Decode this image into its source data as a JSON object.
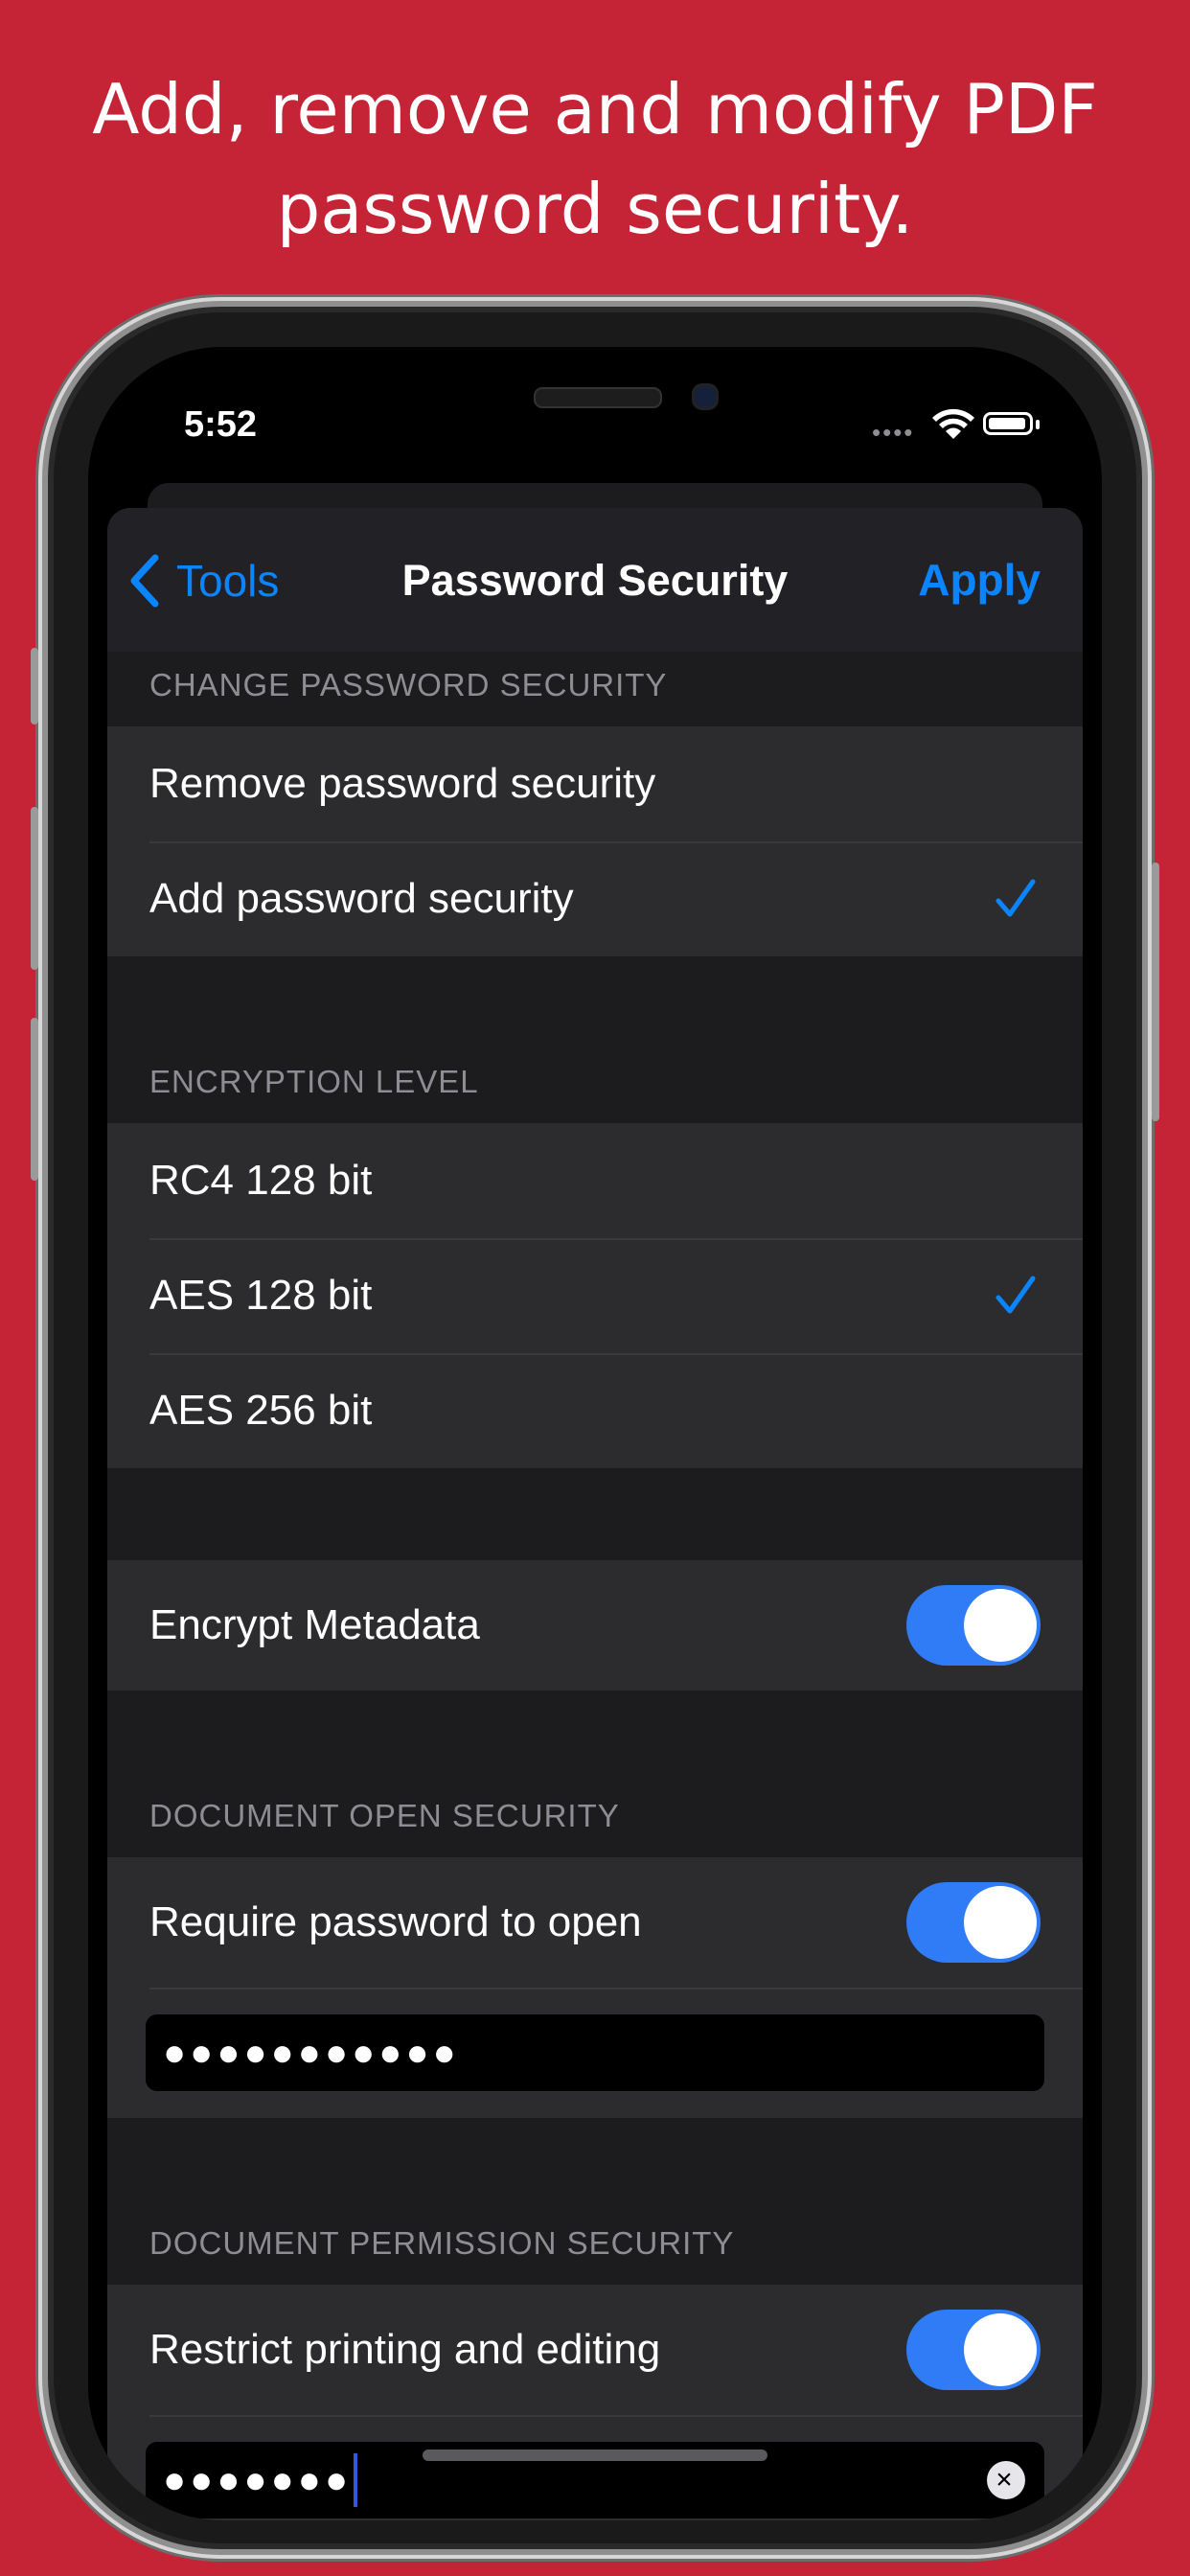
{
  "headline": {
    "line1": "Add, remove and modify PDF",
    "line2": "password security."
  },
  "status_bar": {
    "time": "5:52",
    "signal": "••••"
  },
  "navbar": {
    "back_label": "Tools",
    "title": "Password Security",
    "apply_label": "Apply"
  },
  "sections": {
    "change": {
      "header": "CHANGE PASSWORD SECURITY",
      "items": [
        {
          "label": "Remove password security",
          "checked": false
        },
        {
          "label": "Add password security",
          "checked": true
        }
      ]
    },
    "encryption": {
      "header": "ENCRYPTION LEVEL",
      "items": [
        {
          "label": "RC4 128 bit",
          "checked": false
        },
        {
          "label": "AES 128 bit",
          "checked": true
        },
        {
          "label": "AES 256 bit",
          "checked": false
        }
      ]
    },
    "metadata": {
      "label": "Encrypt Metadata",
      "enabled": true
    },
    "open": {
      "header": "DOCUMENT OPEN SECURITY",
      "label": "Require password to open",
      "enabled": true,
      "password_masked": "●●●●●●●●●●●"
    },
    "permission": {
      "header": "DOCUMENT PERMISSION SECURITY",
      "label": "Restrict printing and editing",
      "enabled": true,
      "password_masked": "●●●●●●●"
    }
  },
  "colors": {
    "background": "#c42436",
    "accent": "#0a84ff",
    "toggle_on": "#2f7cf6"
  }
}
